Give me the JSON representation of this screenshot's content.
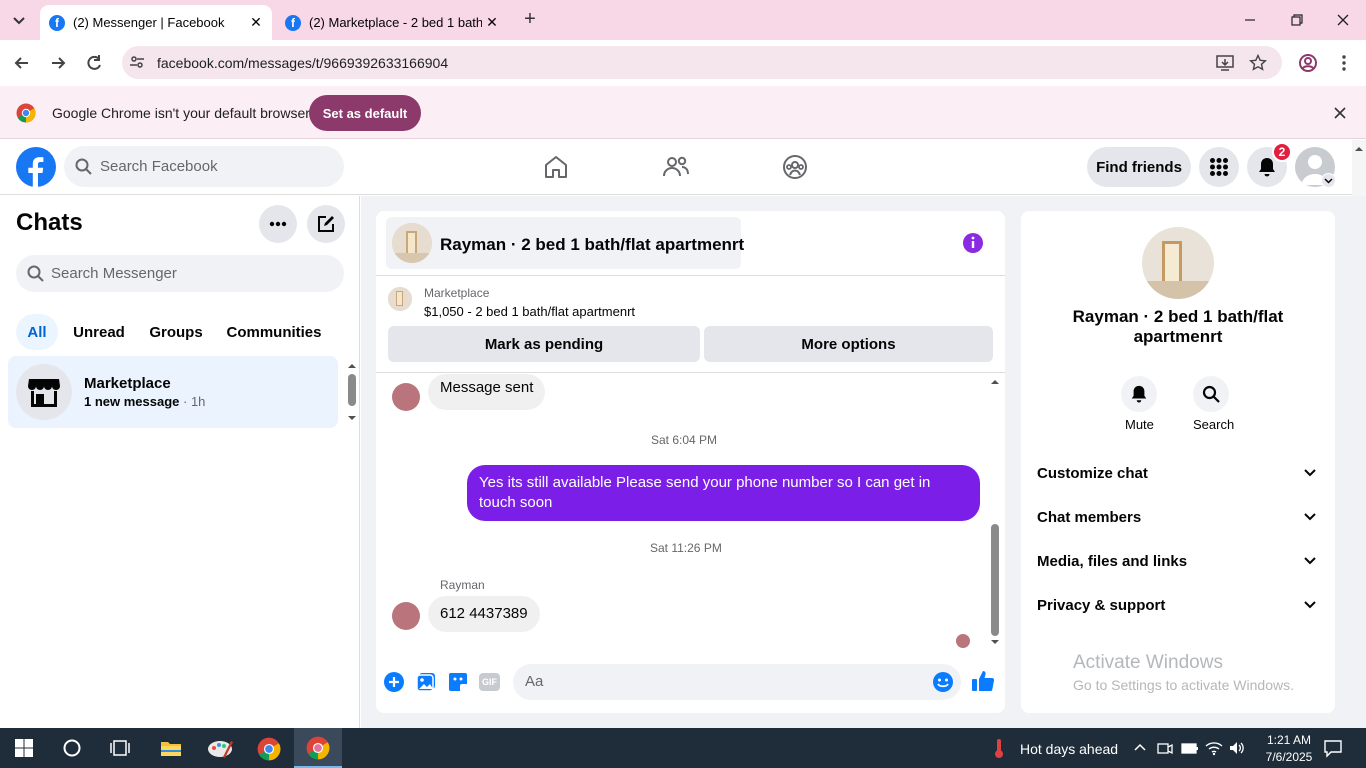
{
  "browser": {
    "tabs": [
      {
        "title": "(2) Messenger | Facebook",
        "active": true
      },
      {
        "title": "(2) Marketplace - 2 bed 1 bath/",
        "active": false
      }
    ],
    "url": "facebook.com/messages/t/9669392633166904",
    "infobar": {
      "text": "Google Chrome isn't your default browser",
      "button": "Set as default"
    }
  },
  "fbnav": {
    "search_placeholder": "Search Facebook",
    "find_friends": "Find friends",
    "notification_count": "2"
  },
  "chats_panel": {
    "title": "Chats",
    "search_placeholder": "Search Messenger",
    "filters": [
      "All",
      "Unread",
      "Groups",
      "Communities"
    ],
    "conversation": {
      "name": "Marketplace",
      "preview": "1 new message",
      "time": " · 1h"
    }
  },
  "conversation": {
    "header_title": "Rayman · 2 bed 1 bath/flat apartmenrt",
    "listing_label": "Marketplace",
    "listing_price": "$1,050 - 2 bed 1 bath/flat apartmenrt",
    "mark_pending": "Mark as pending",
    "more_options": "More options",
    "messages": {
      "partial": "Message sent",
      "ts1": "Sat 6:04 PM",
      "outgoing": "Yes its still available Please send your phone number so I can get in touch soon",
      "ts2": "Sat 11:26 PM",
      "sender": "Rayman",
      "incoming": "612 4437389"
    },
    "composer_placeholder": "Aa"
  },
  "info_panel": {
    "name": "Rayman · 2 bed 1 bath/flat apartmenrt",
    "mute": "Mute",
    "search": "Search",
    "sections": [
      "Customize chat",
      "Chat members",
      "Media, files and links",
      "Privacy & support"
    ]
  },
  "watermark": {
    "line1": "Activate Windows",
    "line2": "Go to Settings to activate Windows."
  },
  "taskbar": {
    "weather": "Hot days ahead",
    "time": "1:21 AM",
    "date": "7/6/2025"
  },
  "colors": {
    "brand_blue": "#1877f2",
    "accent_purple": "#8a2be2",
    "outgoing_bubble": "#7b1fe8"
  }
}
